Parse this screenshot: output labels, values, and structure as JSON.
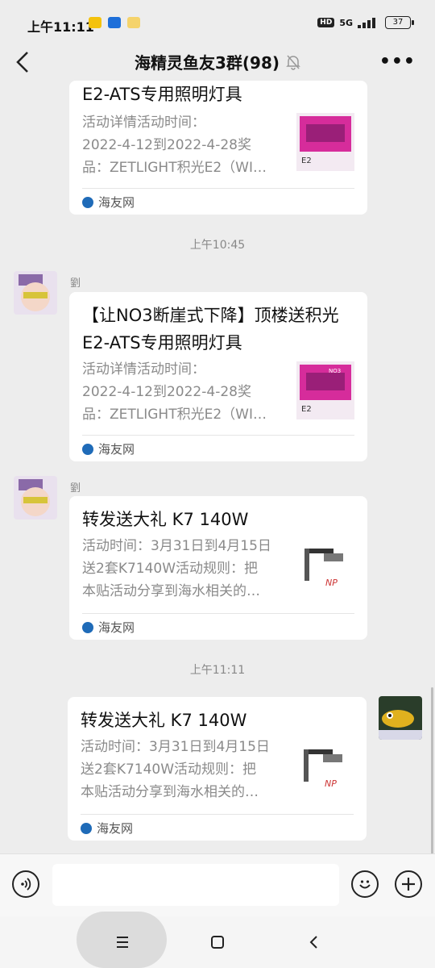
{
  "status": {
    "time": "上午11:11",
    "network": "5G",
    "battery": "37",
    "hd": "HD"
  },
  "header": {
    "title": "海精灵鱼友3群(98)"
  },
  "timestamps": [
    "上午10:45",
    "上午11:11"
  ],
  "messages": [
    {
      "title_line2": "E2-ATS专用照明灯具",
      "desc": [
        "活动详情活动时间：",
        "2022-4-12到2022-4-28奖",
        "品：ZETLIGHT积光E2（WI…"
      ],
      "source": "海友网"
    },
    {
      "sender": "劉",
      "title": [
        "【让NO3断崖式下降】顶楼送积光",
        "E2-ATS专用照明灯具"
      ],
      "desc": [
        "活动详情活动时间：",
        "2022-4-12到2022-4-28奖",
        "品：ZETLIGHT积光E2（WI…"
      ],
      "source": "海友网"
    },
    {
      "sender": "劉",
      "title": [
        "转发送大礼 K7 140W"
      ],
      "desc": [
        "活动时间：3月31日到4月15日",
        "送2套K7140W活动规则：把",
        "本贴活动分享到海水相关的…"
      ],
      "source": "海友网"
    },
    {
      "title": [
        "转发送大礼 K7 140W"
      ],
      "desc": [
        "活动时间：3月31日到4月15日",
        "送2套K7140W活动规则：把",
        "本贴活动分享到海水相关的…"
      ],
      "source": "海友网"
    }
  ],
  "icons": {
    "back": "back-arrow-icon",
    "mute": "bell-muted-icon",
    "more": "more-dots-icon",
    "voice": "voice-icon",
    "emoji": "emoji-icon",
    "plus": "plus-icon"
  },
  "colors": {
    "background": "#ededed",
    "card": "#ffffff",
    "meta_text": "#8a8a8a"
  }
}
